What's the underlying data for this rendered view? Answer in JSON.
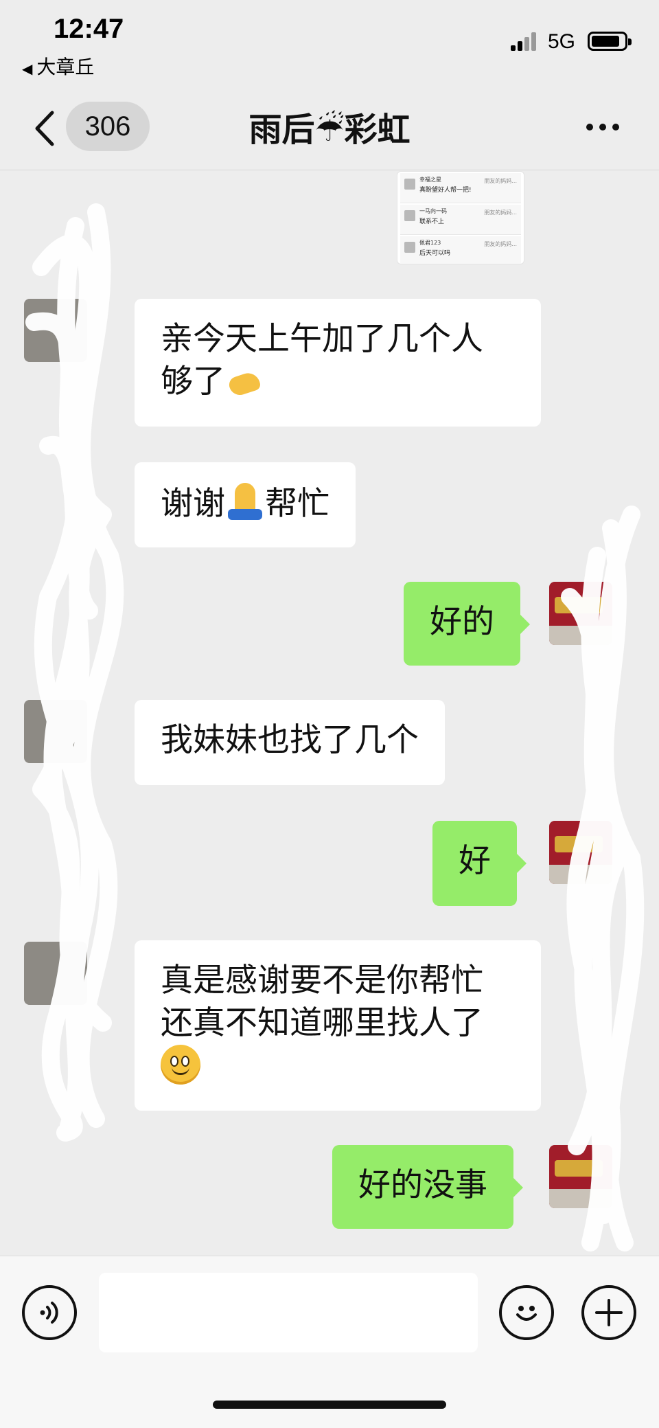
{
  "status_bar": {
    "time": "12:47",
    "back_app": "大章丘",
    "network": "5G"
  },
  "nav": {
    "unread_count": "306",
    "title": "雨后☔彩虹"
  },
  "thumbnail": {
    "rows": [
      {
        "name": "幸福之星",
        "text": "真盼望好人帮一把!",
        "side": "朋友的妈妈..."
      },
      {
        "name": "一马向一码",
        "text": "联系不上",
        "side": "朋友的妈妈..."
      },
      {
        "name": "佩君123",
        "text": "后天可以吗",
        "side": "朋友的妈妈..."
      }
    ]
  },
  "messages": [
    {
      "side": "in",
      "text": "亲今天上午加了几个人",
      "text2": "够了",
      "emoji": "ok-hand"
    },
    {
      "side": "in",
      "text_a": "谢谢",
      "emoji": "folded-hands",
      "text_b": "帮忙"
    },
    {
      "side": "out",
      "text": "好的"
    },
    {
      "side": "in",
      "text": "我妹妹也找了几个"
    },
    {
      "side": "out",
      "text": "好"
    },
    {
      "side": "in",
      "text": "真是感谢要不是你帮忙",
      "text2": "还真不知道哪里找人了",
      "emoji": "smile"
    },
    {
      "side": "out",
      "text": "好的没事"
    }
  ],
  "input": {
    "value": "",
    "placeholder": ""
  },
  "colors": {
    "background": "#ededed",
    "outgoing_bubble": "#95ec69",
    "incoming_bubble": "#ffffff"
  }
}
